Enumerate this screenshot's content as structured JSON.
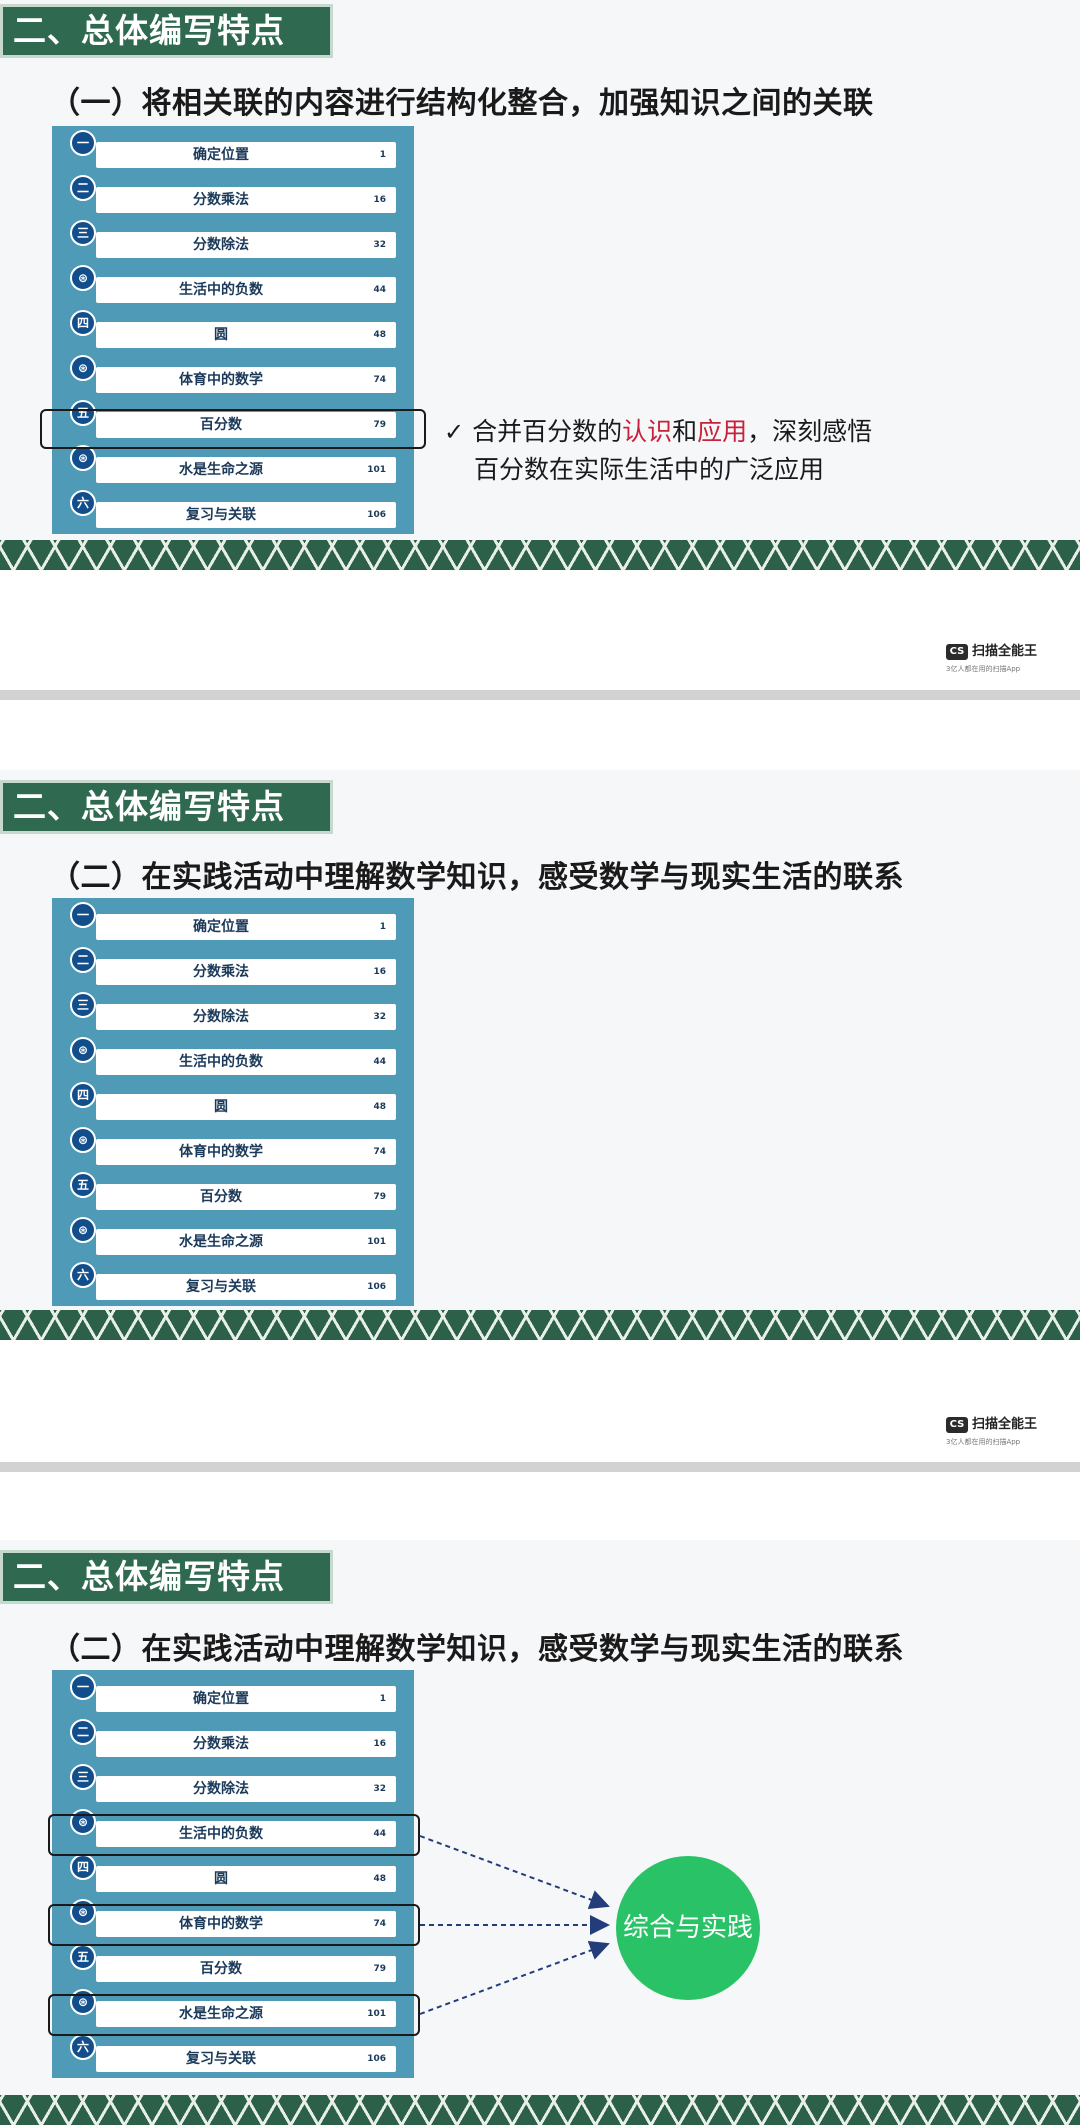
{
  "slide1": {
    "banner": "二、总体编写特点",
    "subtitle": "（一）将相关联的内容进行结构化整合，加强知识之间的关联",
    "note": {
      "check": "✓",
      "p1": "合并百分数的",
      "h1": "认识",
      "p2": "和",
      "h2": "应用",
      "p3": "，深刻感悟",
      "line2": "百分数在实际生活中的广泛应用"
    }
  },
  "slide2": {
    "banner": "二、总体编写特点",
    "subtitle": "（二）在实践活动中理解数学知识，感受数学与现实生活的联系"
  },
  "slide3": {
    "banner": "二、总体编写特点",
    "subtitle": "（二）在实践活动中理解数学知识，感受数学与现实生活的联系",
    "circle_label": "综合与实践"
  },
  "toc": [
    {
      "badge": "一",
      "title": "确定位置",
      "page": "1"
    },
    {
      "badge": "二",
      "title": "分数乘法",
      "page": "16"
    },
    {
      "badge": "三",
      "title": "分数除法",
      "page": "32"
    },
    {
      "badge": "⊛",
      "title": "生活中的负数",
      "page": "44"
    },
    {
      "badge": "四",
      "title": "圆",
      "page": "48"
    },
    {
      "badge": "⊛",
      "title": "体育中的数学",
      "page": "74"
    },
    {
      "badge": "五",
      "title": "百分数",
      "page": "79"
    },
    {
      "badge": "⊛",
      "title": "水是生命之源",
      "page": "101"
    },
    {
      "badge": "六",
      "title": "复习与关联",
      "page": "106"
    }
  ],
  "watermark": {
    "logo": "CS",
    "name": "扫描全能王",
    "tagline": "3亿人都在用的扫描App"
  },
  "colors": {
    "banner": "#2f6a50",
    "toc_panel": "#4f9bb7",
    "badge": "#134e8c",
    "accent": "#c8213a",
    "circle": "#29c267"
  }
}
